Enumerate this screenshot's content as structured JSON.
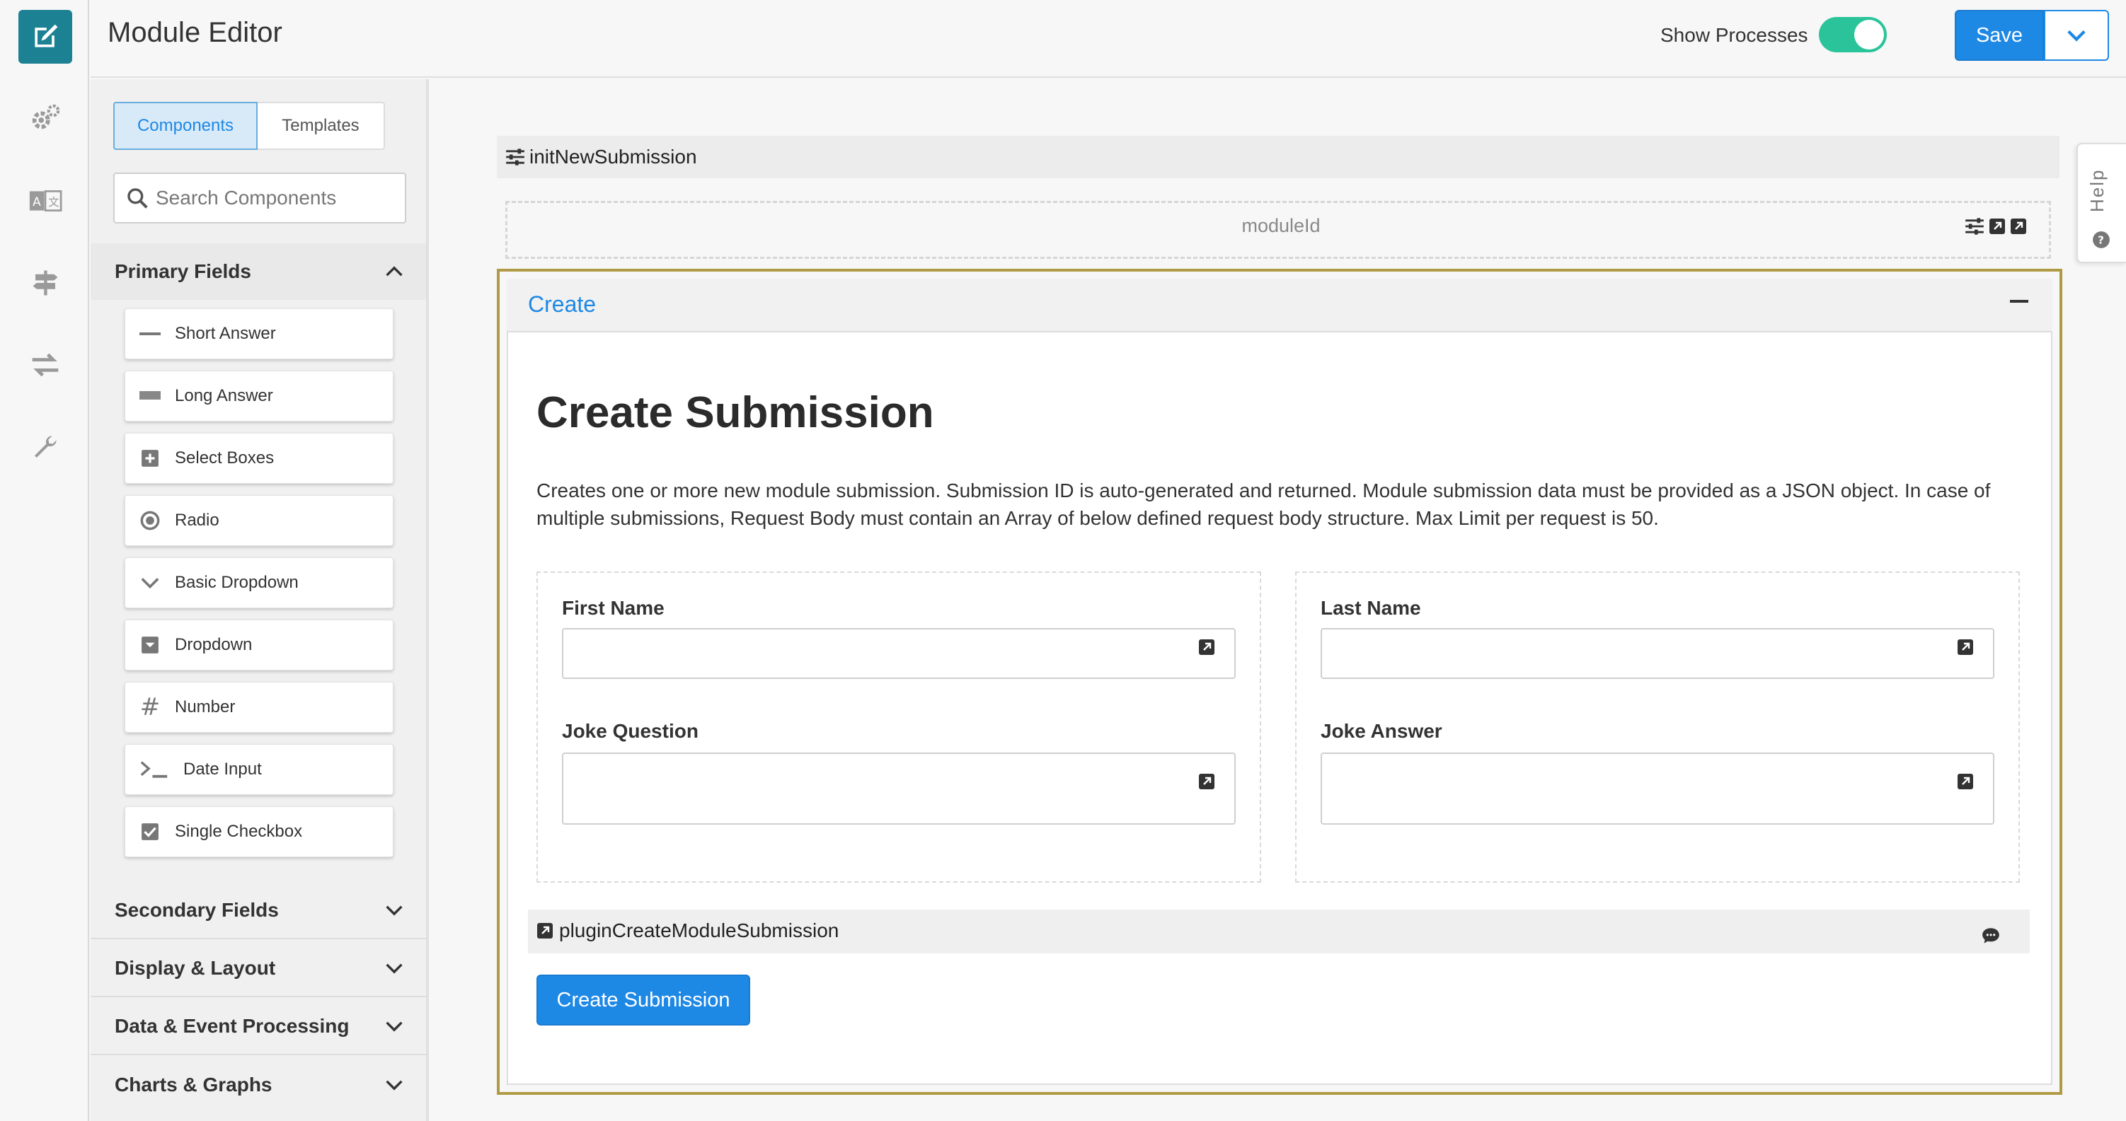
{
  "header": {
    "title": "Module Editor",
    "show_processes_label": "Show Processes",
    "show_processes_on": true,
    "save_label": "Save"
  },
  "rail": {
    "items": [
      {
        "icon": "edit-icon",
        "active": true
      },
      {
        "icon": "gears-icon"
      },
      {
        "icon": "translate-icon"
      },
      {
        "icon": "signpost-icon"
      },
      {
        "icon": "transfer-icon"
      },
      {
        "icon": "wrench-icon"
      }
    ]
  },
  "sidebar": {
    "tabs": [
      "Components",
      "Templates"
    ],
    "active_tab": "Components",
    "search_placeholder": "Search Components",
    "primary_title": "Primary Fields",
    "primary_items": [
      {
        "label": "Short Answer",
        "icon": "short-answer-icon"
      },
      {
        "label": "Long Answer",
        "icon": "long-answer-icon"
      },
      {
        "label": "Select Boxes",
        "icon": "plus-square-icon"
      },
      {
        "label": "Radio",
        "icon": "radio-icon"
      },
      {
        "label": "Basic Dropdown",
        "icon": "chevron-down-icon"
      },
      {
        "label": "Dropdown",
        "icon": "dropdown-square-icon"
      },
      {
        "label": "Number",
        "icon": "hash-icon"
      },
      {
        "label": "Date Input",
        "icon": "terminal-icon"
      },
      {
        "label": "Single Checkbox",
        "icon": "checkbox-icon"
      }
    ],
    "sections": [
      "Secondary Fields",
      "Display & Layout",
      "Data & Event Processing",
      "Charts & Graphs"
    ]
  },
  "canvas": {
    "init_process": "initNewSubmission",
    "module_field": "moduleId",
    "panel_title": "Create",
    "heading": "Create Submission",
    "description": "Creates one or more new module submission. Submission ID is auto-generated and returned. Module submission data must be provided as a JSON object. In case of multiple submissions, Request Body must contain an Array of below defined request body structure. Max Limit per request is 50.",
    "fields": {
      "first_name": "First Name",
      "last_name": "Last Name",
      "joke_question": "Joke Question",
      "joke_answer": "Joke Answer"
    },
    "plugin": "pluginCreateModuleSubmission",
    "submit_label": "Create Submission"
  },
  "help": {
    "label": "Help"
  },
  "colors": {
    "accent": "#1e88e5",
    "rail_active": "#1c8193",
    "toggle_on": "#2bc49a",
    "frame": "#b09a45"
  }
}
